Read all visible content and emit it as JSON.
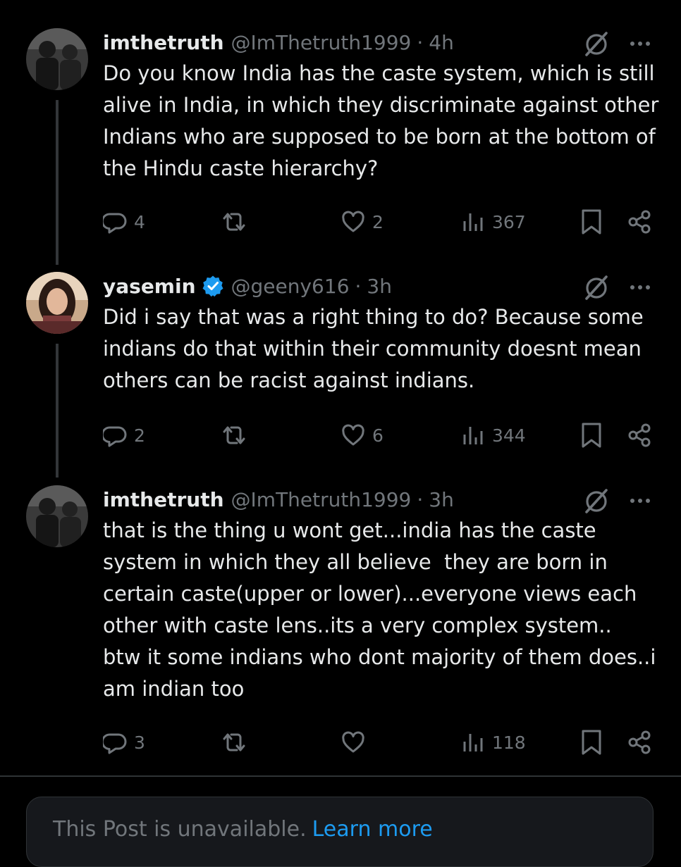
{
  "posts": [
    {
      "name": "imthetruth",
      "handle": "@ImThetruth1999",
      "separator": "·",
      "time": "4h",
      "text": "Do you know India has the caste system, which is still alive in India, in which they discriminate against other Indians who are supposed to be born at the bottom of the Hindu caste hierarchy?",
      "replies": "4",
      "reposts": "",
      "likes": "2",
      "views": "367",
      "avatar": "avatar-two-men-photo"
    },
    {
      "name": "yasemin",
      "verified": true,
      "handle": "@geeny616",
      "separator": "·",
      "time": "3h",
      "text": "Did i say that was a right thing to do? Because some indians do that within their community doesnt mean others can be racist against indians.",
      "replies": "2",
      "reposts": "",
      "likes": "6",
      "views": "344",
      "avatar": "avatar-woman-photo"
    },
    {
      "name": "imthetruth",
      "handle": "@ImThetruth1999",
      "separator": "·",
      "time": "3h",
      "text": "that is the thing u wont get...india has the caste system in which they all believe  they are born in certain caste(upper or lower)...everyone views each other with caste lens..its a very complex system..\nbtw it some indians who dont majority of them does..i am indian too",
      "replies": "3",
      "reposts": "",
      "likes": "",
      "views": "118",
      "avatar": "avatar-two-men-photo"
    }
  ],
  "unavailable": {
    "text": "This Post is unavailable.",
    "link": "Learn more"
  },
  "colors": {
    "background": "#000000",
    "text": "#e7e9ea",
    "secondary": "#71767b",
    "accent": "#1d9bf0",
    "verified": "#1d9bf0"
  },
  "icons": [
    "reply-icon",
    "repost-icon",
    "like-icon",
    "views-icon",
    "bookmark-icon",
    "share-icon",
    "grok-icon",
    "more-icon",
    "verified-badge-icon"
  ]
}
